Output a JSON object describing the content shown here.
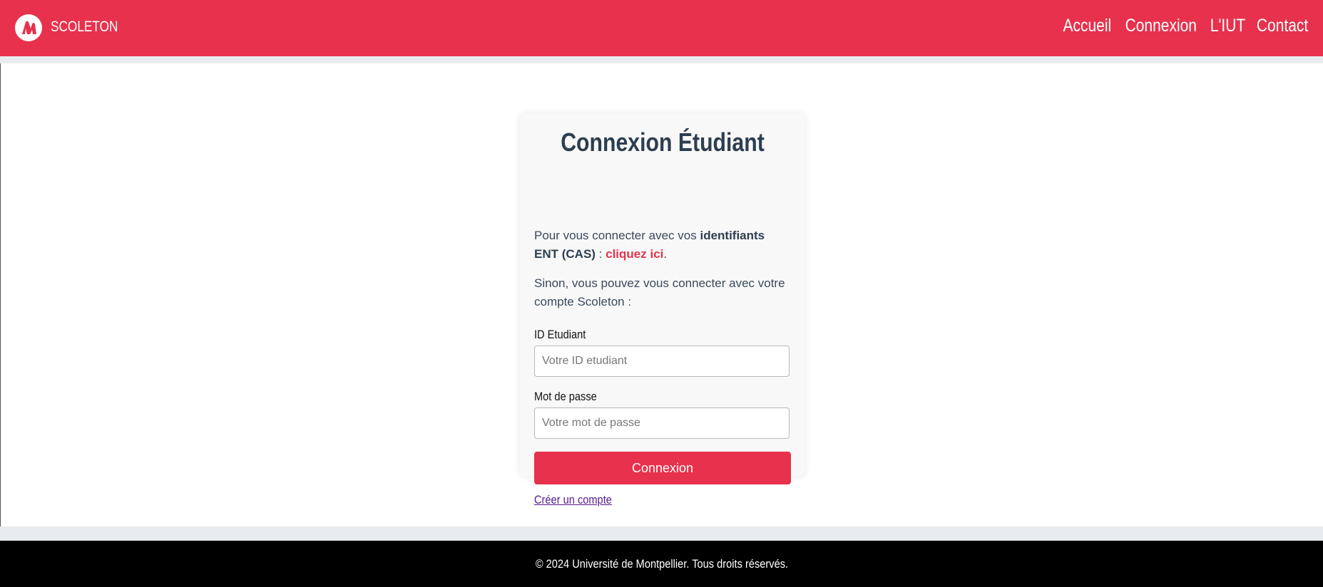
{
  "header": {
    "brand": "SCOLETON",
    "logo_icon": "scoleton-logo-icon",
    "nav": [
      "Accueil",
      "Connexion",
      "L'IUT",
      "Contact"
    ]
  },
  "card": {
    "title": "Connexion Étudiant",
    "intro_text": "Pour vous connecter avec vos ",
    "intro_strong": "identifiants ENT (CAS)",
    "intro_sep": " : ",
    "cas_link": "cliquez ici",
    "intro_end": ".",
    "alt_text": "Sinon, vous pouvez vous connecter avec votre compte Scoleton :",
    "id_label": "ID Etudiant",
    "id_placeholder": "Votre ID etudiant",
    "password_label": "Mot de passe",
    "password_placeholder": "Votre mot de passe",
    "submit_label": "Connexion",
    "create_account": "Créer un compte"
  },
  "footer": {
    "text": "© 2024 Université de Montpellier. Tous droits réservés."
  },
  "colors": {
    "brand": "#e8314c",
    "title": "#2c3e50",
    "footer_bg": "#000000"
  }
}
